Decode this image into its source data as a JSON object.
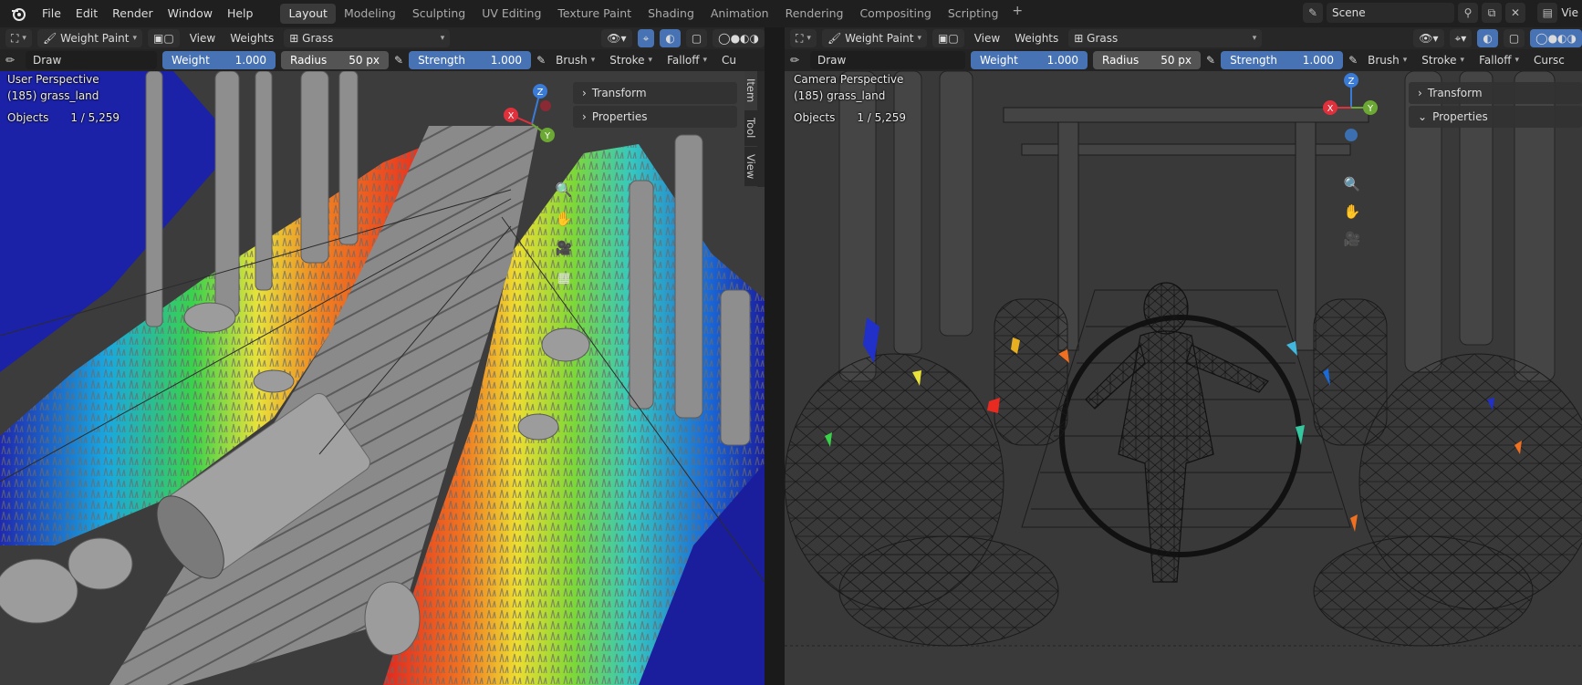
{
  "menus": [
    "File",
    "Edit",
    "Render",
    "Window",
    "Help"
  ],
  "workspaces": [
    "Layout",
    "Modeling",
    "Sculpting",
    "UV Editing",
    "Texture Paint",
    "Shading",
    "Animation",
    "Rendering",
    "Compositing",
    "Scripting"
  ],
  "active_workspace": "Layout",
  "scene": {
    "name": "Scene",
    "viewlayer_partial": "Vie"
  },
  "left": {
    "mode": "Weight Paint",
    "view_menu": "View",
    "weights_menu": "Weights",
    "vgroup": "Grass",
    "brush_name": "Draw",
    "weight_label": "Weight",
    "weight_value": "1.000",
    "radius_label": "Radius",
    "radius_value": "50 px",
    "strength_label": "Strength",
    "strength_value": "1.000",
    "brush_menu": "Brush",
    "stroke_menu": "Stroke",
    "falloff_menu": "Falloff",
    "cursor_partial": "Cu",
    "view_name": "User Perspective",
    "object_name": "(185) grass_land",
    "objects_label": "Objects",
    "objects_value": "1 / 5,259",
    "panel_transform": "Transform",
    "panel_properties": "Properties",
    "side_tabs": [
      "Item",
      "Tool",
      "View"
    ],
    "axes": {
      "x": "X",
      "y": "Y",
      "z": "Z"
    }
  },
  "right": {
    "mode": "Weight Paint",
    "view_menu": "View",
    "weights_menu": "Weights",
    "vgroup": "Grass",
    "brush_name": "Draw",
    "weight_label": "Weight",
    "weight_value": "1.000",
    "radius_label": "Radius",
    "radius_value": "50 px",
    "strength_label": "Strength",
    "strength_value": "1.000",
    "brush_menu": "Brush",
    "stroke_menu": "Stroke",
    "falloff_menu": "Falloff",
    "cursor_partial": "Cursc",
    "view_name": "Camera Perspective",
    "object_name": "(185) grass_land",
    "objects_label": "Objects",
    "objects_value": "1 / 5,259",
    "panel_transform": "Transform",
    "panel_properties": "Properties",
    "axes": {
      "x": "X",
      "y": "Y",
      "z": "Z"
    }
  },
  "colors": {
    "accent": "#4772b3",
    "axis_x": "#e0303c",
    "axis_y": "#6ca834",
    "axis_z": "#3b7bd8"
  }
}
